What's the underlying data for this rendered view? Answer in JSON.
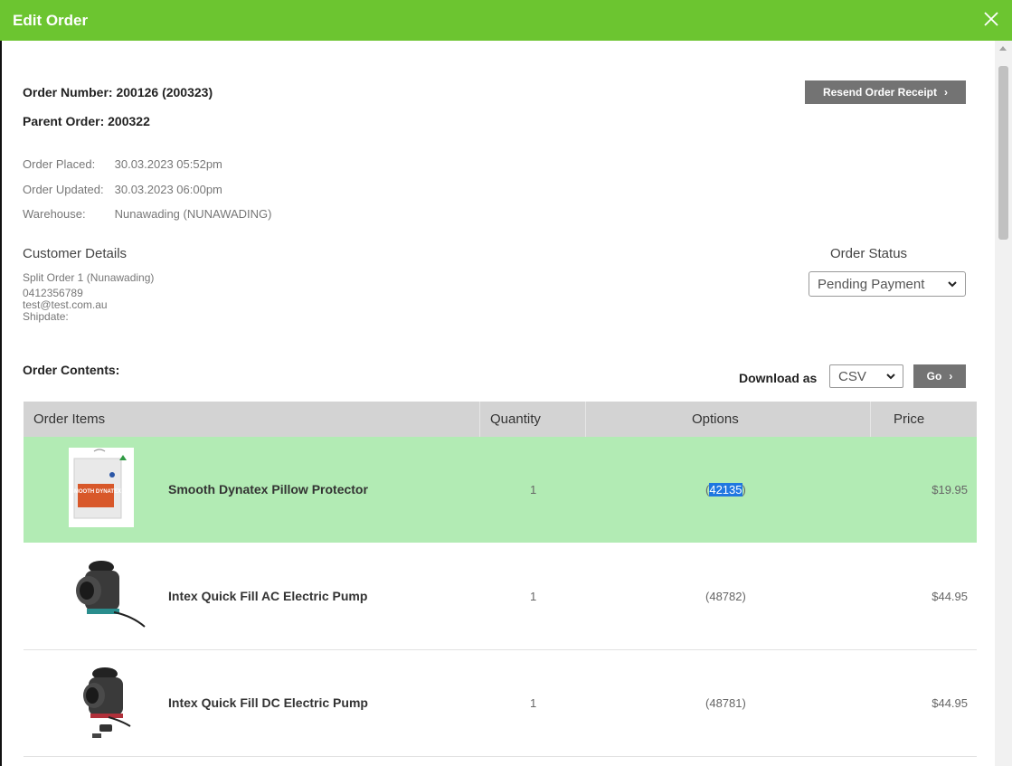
{
  "header": {
    "title": "Edit Order"
  },
  "order": {
    "number_label": "Order Number: 200126 (200323)",
    "parent_label": "Parent Order: 200322",
    "resend_label": "Resend Order Receipt",
    "placed_key": "Order Placed:",
    "placed_value": "30.03.2023 05:52pm",
    "updated_key": "Order Updated:",
    "updated_value": "30.03.2023 06:00pm",
    "warehouse_key": "Warehouse:",
    "warehouse_value": "Nunawading (NUNAWADING)"
  },
  "customer": {
    "title": "Customer Details",
    "name": "Split Order 1 (Nunawading)",
    "phone": "0412356789",
    "email": "test@test.com.au",
    "shipdate": "Shipdate:"
  },
  "status": {
    "title": "Order Status",
    "selected": "Pending Payment"
  },
  "contents": {
    "title": "Order Contents:",
    "download_label": "Download as",
    "format_selected": "CSV",
    "go_label": "Go"
  },
  "table": {
    "headers": [
      "Order Items",
      "Quantity",
      "Options",
      "Price"
    ],
    "rows": [
      {
        "name": "Smooth Dynatex Pillow Protector",
        "qty": "1",
        "opt_open": "(",
        "opt_code": "42135",
        "opt_close": ")",
        "price": "$19.95",
        "thumb_text": "SMOOTH DYNATEX"
      },
      {
        "name": "Intex Quick Fill AC Electric Pump",
        "qty": "1",
        "opt_open": "(",
        "opt_code": "48782",
        "opt_close": ")",
        "price": "$44.95"
      },
      {
        "name": "Intex Quick Fill DC Electric Pump",
        "qty": "1",
        "opt_open": "(",
        "opt_code": "48781",
        "opt_close": ")",
        "price": "$44.95"
      }
    ]
  },
  "colors": {
    "header_green": "#6cc530",
    "row_highlight": "#b2ebb4",
    "button_gray": "#737373",
    "selection_blue": "#1f77e0"
  },
  "icons": {
    "close": "close-icon",
    "chevron": "chevron-right-icon",
    "dropdown": "chevron-down-icon"
  }
}
